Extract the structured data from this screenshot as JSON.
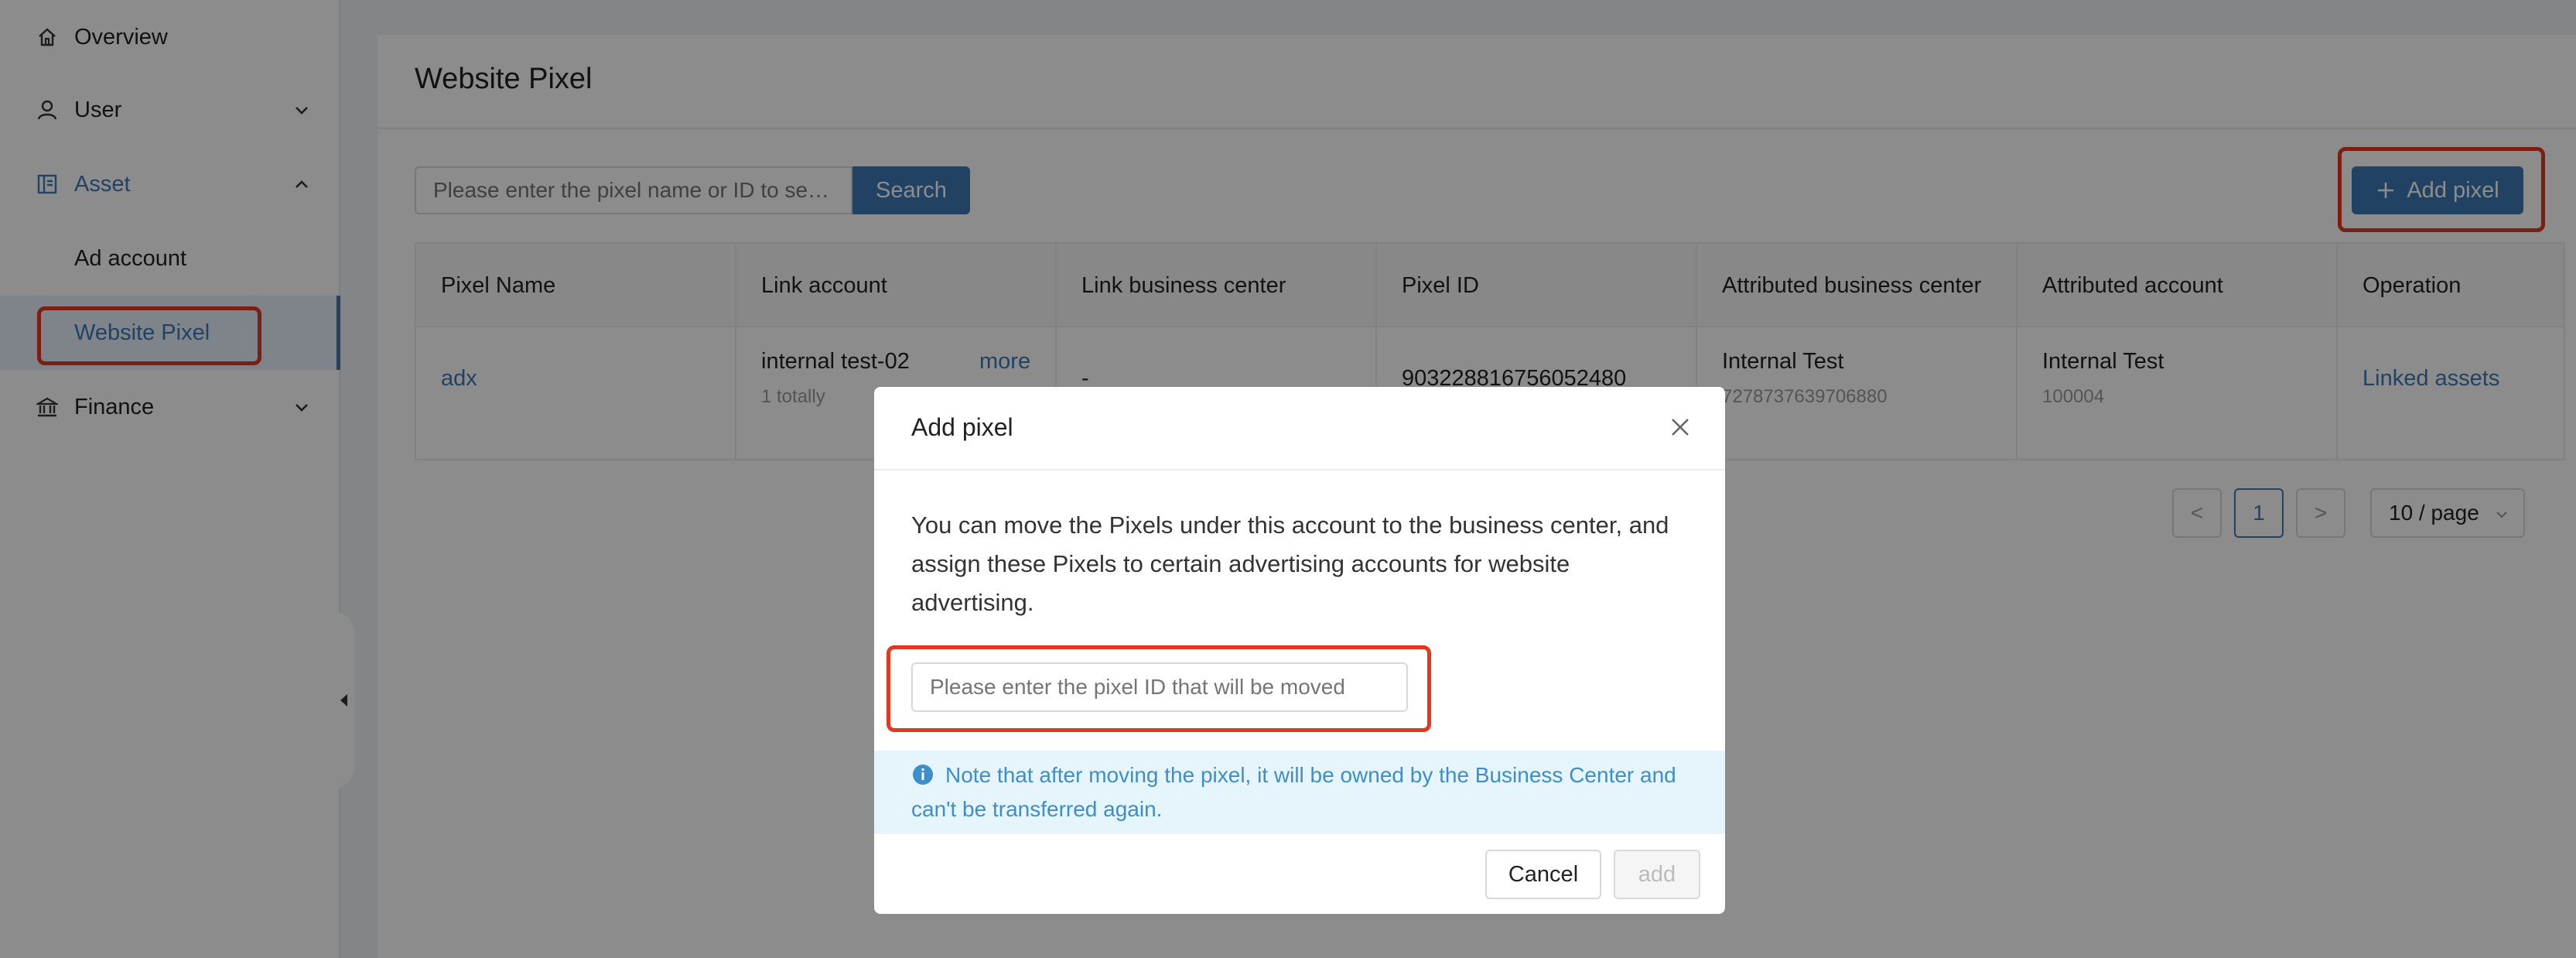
{
  "sidebar": {
    "items": [
      {
        "label": "Overview",
        "icon": "home-icon"
      },
      {
        "label": "User",
        "icon": "user-icon"
      },
      {
        "label": "Asset",
        "icon": "asset-icon"
      },
      {
        "label": "Ad account"
      },
      {
        "label": "Website Pixel"
      },
      {
        "label": "Finance",
        "icon": "bank-icon"
      }
    ]
  },
  "page": {
    "title": "Website Pixel",
    "search_placeholder": "Please enter the pixel name or ID to se…",
    "search_label": "Search",
    "add_pixel_label": "Add pixel"
  },
  "table": {
    "headers": [
      "Pixel Name",
      "Link account",
      "Link business center",
      "Pixel ID",
      "Attributed business center",
      "Attributed account",
      "Operation"
    ],
    "rows": [
      {
        "pixel_name": "adx",
        "link_account": "internal test-02",
        "link_account_more": "more",
        "link_account_sub": "1 totally",
        "link_bc": "-",
        "pixel_id": "903228816756052480",
        "attr_bc": "Internal Test",
        "attr_bc_sub": "7278737639706880",
        "attr_account": "Internal Test",
        "attr_account_sub": "100004",
        "operation": "Linked assets"
      }
    ]
  },
  "pagination": {
    "prev": "<",
    "current": "1",
    "next": ">",
    "page_size": "10 / page"
  },
  "modal": {
    "title": "Add pixel",
    "description": "You can move the Pixels under this account to the business center, and assign these Pixels to certain advertising accounts for website advertising.",
    "input_placeholder": "Please enter the pixel ID that will be moved",
    "notice": "Note that after moving the pixel, it will be owned by the Business Center and can't be transferred again.",
    "cancel_label": "Cancel",
    "add_label": "add"
  },
  "colors": {
    "accent": "#3d78b5",
    "highlight": "#e5361f",
    "notice_bg": "#e6f4fc"
  }
}
